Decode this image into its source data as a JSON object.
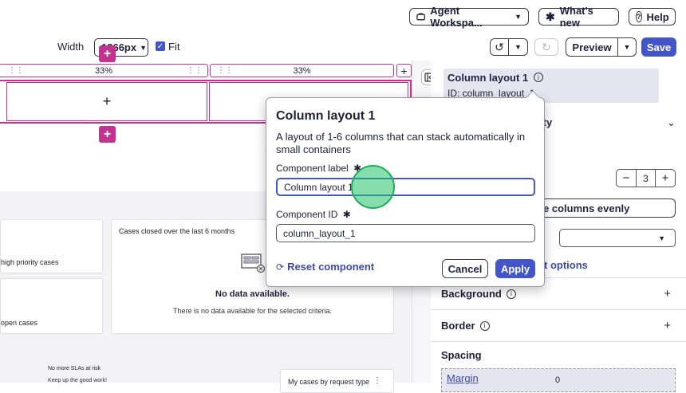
{
  "topbar": {
    "workspace_label": "Agent Workspa...",
    "whats_new_label": "What's new",
    "help_label": "Help"
  },
  "toolbar": {
    "width_label": "Width",
    "width_value": "1366px",
    "fit_label": "Fit",
    "fit_checked": true,
    "preview_label": "Preview",
    "save_label": "Save"
  },
  "layout_editor": {
    "col1_width": "33%",
    "col2_width": "33%",
    "add_symbol": "+",
    "cell_plus": "+"
  },
  "canvas": {
    "card_left_top_text": "high priority cases",
    "card_left_bottom_text": "open cases",
    "chart_card_title": "Cases closed over the last 6 months",
    "no_data_title": "No data available.",
    "no_data_sub": "There is no data available for the selected criteria.",
    "slas_title": "No more SLAs at risk",
    "slas_sub": "Keep up the good work!",
    "request_type_label": "My cases by request type"
  },
  "popover": {
    "title": "Column layout 1",
    "description": "A layout of 1-6 columns that can stack automatically in small containers",
    "label_field_label": "Component label",
    "label_field_value": "Column layout 1",
    "id_field_label": "Component ID",
    "id_field_value": "column_layout_1",
    "reset_label": "Reset component",
    "cancel_label": "Cancel",
    "apply_label": "Apply"
  },
  "right_panel": {
    "header_title": "Column layout 1",
    "header_id": "ID: column_layout_1",
    "property_tail": "ity",
    "columns_count": "3",
    "distribute_label": "e columns evenly",
    "options_link": "t options",
    "sections": [
      "Background",
      "Border"
    ],
    "spacing_label": "Spacing",
    "margin_label": "Margin",
    "margin_value": "0"
  },
  "colors": {
    "accent": "#4356c9",
    "magenta": "#c2338f",
    "focus_ring": "#25c26a"
  }
}
